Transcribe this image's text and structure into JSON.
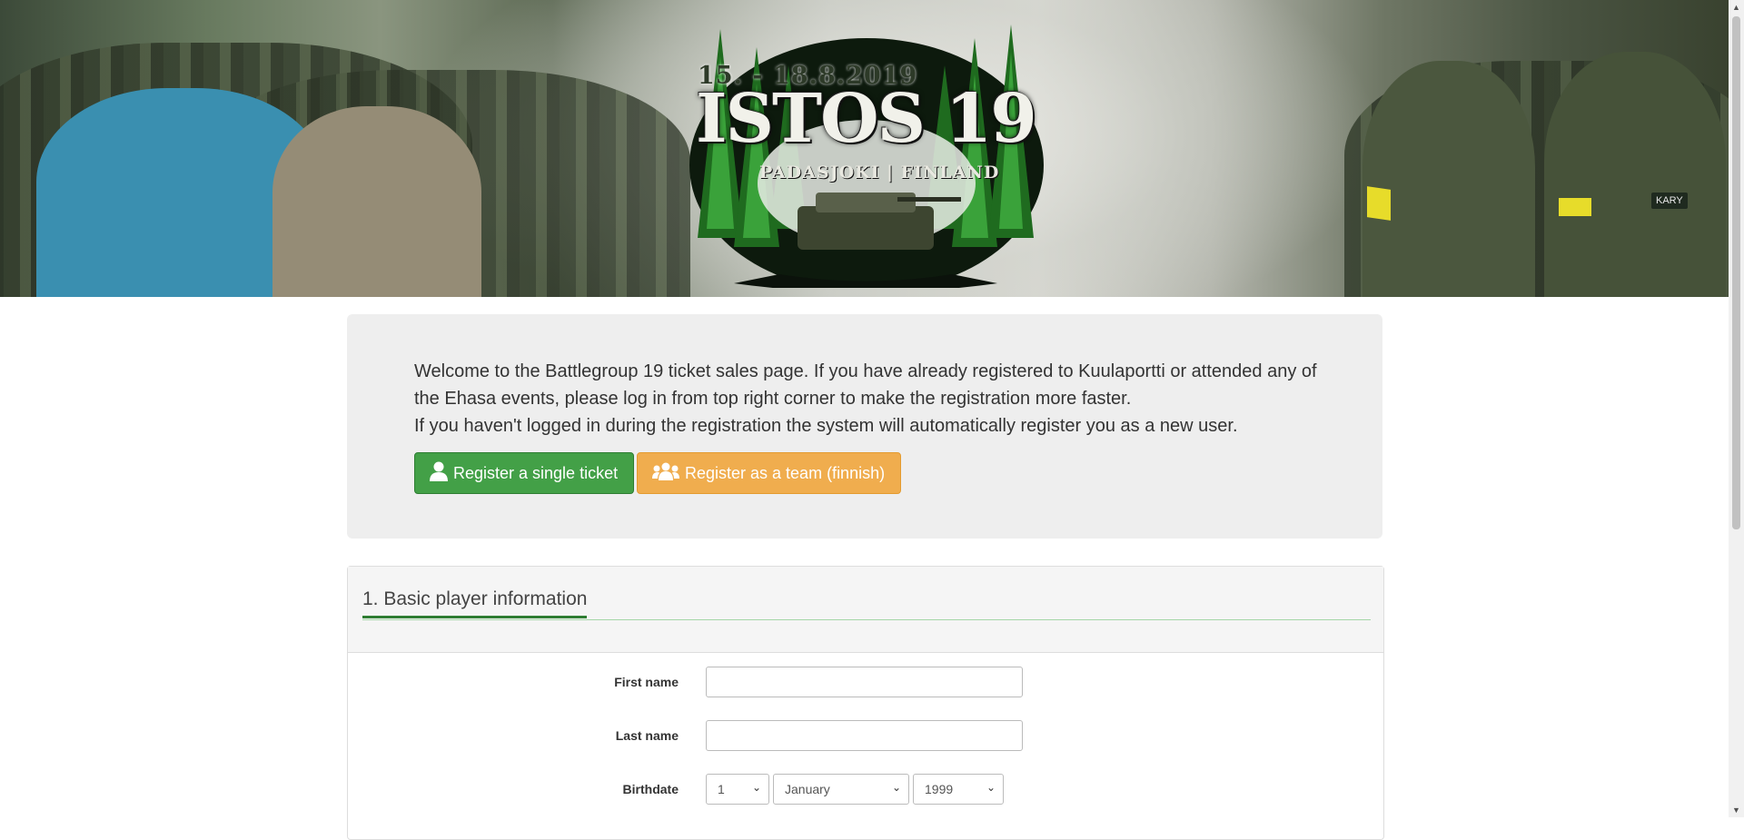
{
  "banner": {
    "logo": {
      "dates": "15. - 18.8.2019",
      "title": "ISTOS 19",
      "location": "PADASJOKI | FINLAND"
    },
    "badge": "KARY"
  },
  "intro": {
    "text_line1": "Welcome to the Battlegroup 19 ticket sales page. If you have already registered to Kuulaportti or attended any of the Ehasa events, please log in from top right corner to make the registration more faster.",
    "text_line2": "If you haven't logged in during the registration the system will automatically register you as a new user.",
    "single_ticket_label": "Register a single ticket",
    "team_label": "Register as a team (finnish)"
  },
  "form": {
    "section_title": "1. Basic player information",
    "first_name_label": "First name",
    "first_name_value": "",
    "last_name_label": "Last name",
    "last_name_value": "",
    "birthdate_label": "Birthdate",
    "birth_day": "1",
    "birth_month": "January",
    "birth_year": "1999"
  },
  "colors": {
    "green_button": "#43a047",
    "orange_button": "#f0ad4e",
    "section_accent": "#2e7d32"
  }
}
